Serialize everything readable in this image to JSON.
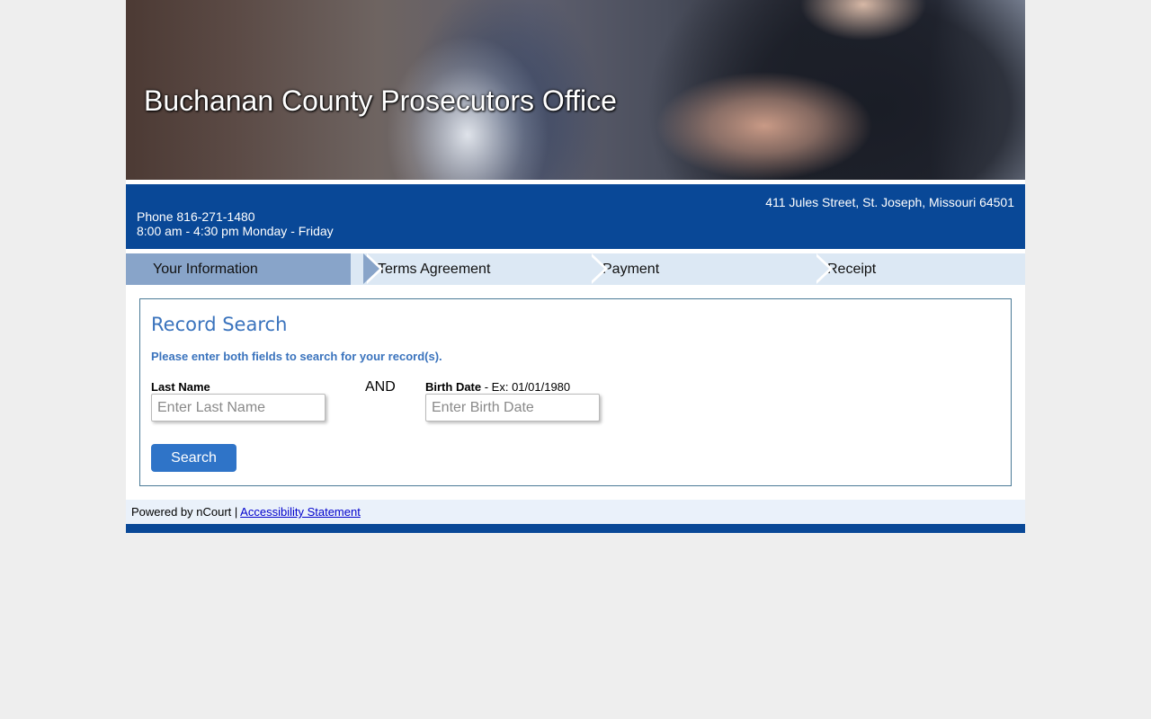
{
  "header": {
    "title": "Buchanan County Prosecutors Office"
  },
  "contact": {
    "address": "411 Jules Street, St. Joseph, Missouri 64501",
    "phone": "Phone 816-271-1480",
    "hours": "8:00 am - 4:30 pm Monday - Friday"
  },
  "steps": [
    {
      "label": "Your Information",
      "active": true
    },
    {
      "label": "Terms Agreement",
      "active": false
    },
    {
      "label": "Payment",
      "active": false
    },
    {
      "label": "Receipt",
      "active": false
    }
  ],
  "search": {
    "heading": "Record Search",
    "instructions": "Please enter both fields to search for your record(s).",
    "last_name_label": "Last Name",
    "last_name_placeholder": "Enter Last Name",
    "last_name_value": "",
    "and_label": "AND",
    "birth_date_label": "Birth Date",
    "birth_date_hint": " - Ex: 01/01/1980",
    "birth_date_placeholder": "Enter Birth Date",
    "birth_date_value": "",
    "button_label": "Search"
  },
  "footer": {
    "powered_by": "Powered by nCourt | ",
    "accessibility_link": "Accessibility Statement"
  },
  "colors": {
    "brand_blue": "#094897",
    "accent_blue": "#3a73bd",
    "button_blue": "#2f74c8",
    "active_step": "#88a4c9",
    "inactive_step": "#dce8f4"
  }
}
